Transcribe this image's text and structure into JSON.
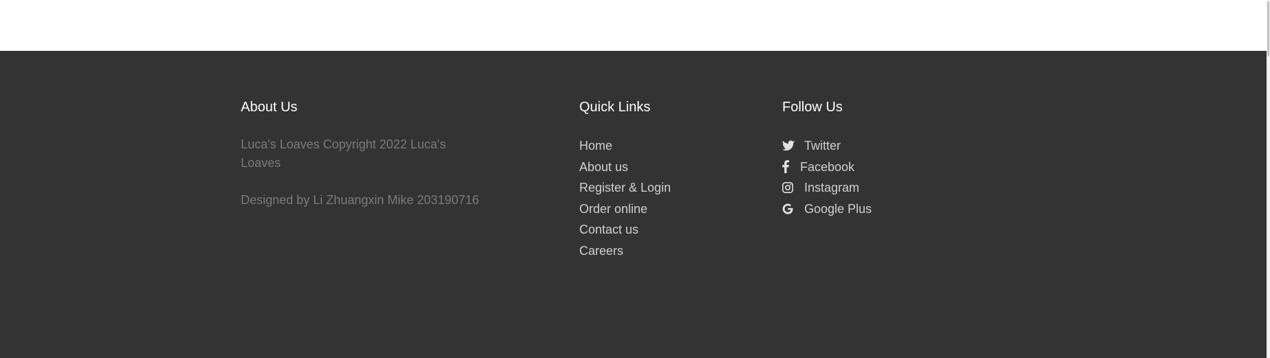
{
  "about": {
    "title": "About Us",
    "text": "Luca's Loaves Copyright 2022 Luca's Loaves",
    "designed_by": "Designed by Li Zhuangxin Mike 203190716"
  },
  "quick_links": {
    "title": "Quick Links",
    "items": [
      "Home",
      "About us",
      "Register & Login",
      "Order online",
      "Contact us",
      "Careers"
    ]
  },
  "follow": {
    "title": "Follow Us",
    "items": [
      {
        "label": "Twitter",
        "icon": "twitter-icon"
      },
      {
        "label": "Facebook",
        "icon": "facebook-icon"
      },
      {
        "label": "Instagram",
        "icon": "instagram-icon"
      },
      {
        "label": "Google Plus",
        "icon": "google-plus-icon"
      }
    ]
  },
  "colors": {
    "footer_bg": "#333333",
    "heading": "#ffffff",
    "muted_text": "#7a7a7a",
    "link_text": "#d0d0d0"
  }
}
